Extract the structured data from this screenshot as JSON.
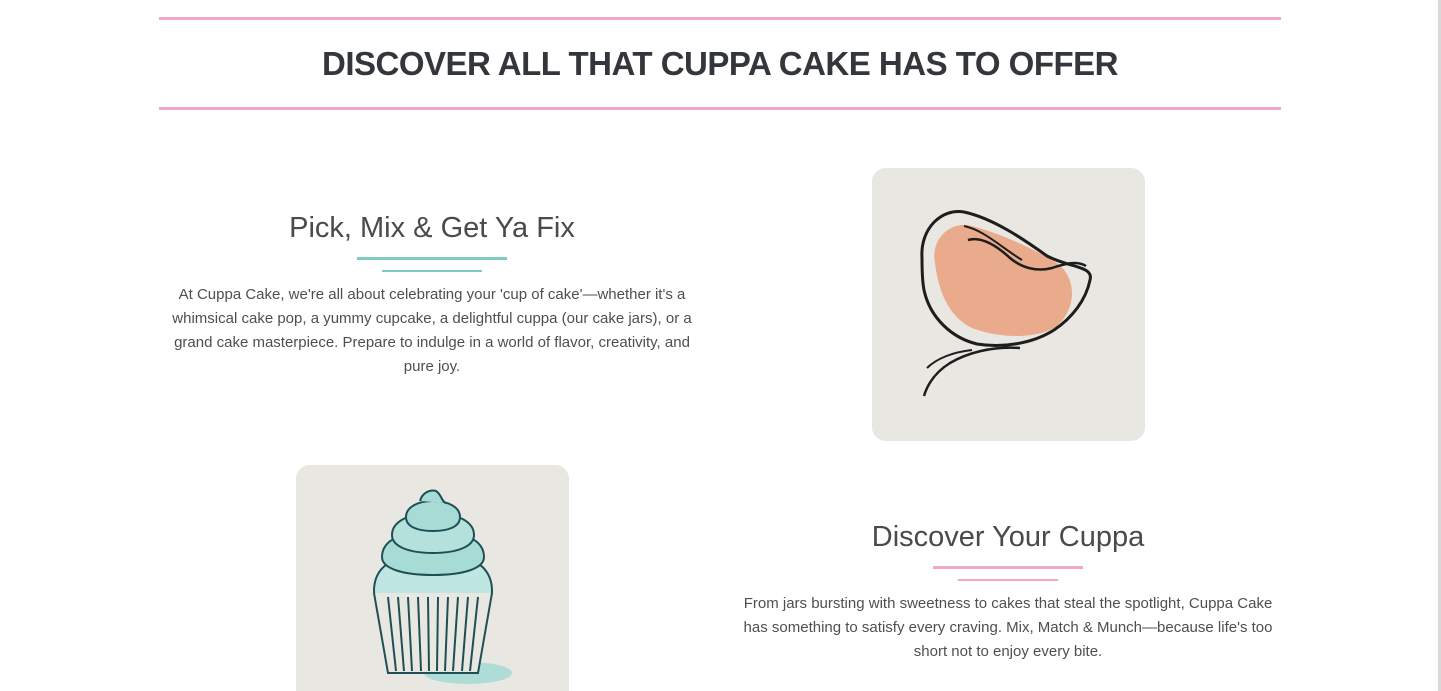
{
  "banner": {
    "heading": "DISCOVER ALL THAT CUPPA CAKE HAS TO OFFER"
  },
  "features": [
    {
      "title": "Pick, Mix & Get Ya Fix",
      "text": "At Cuppa Cake, we're all about celebrating your 'cup of cake'—whether it's a whimsical cake pop, a yummy cupcake, a delightful cuppa (our cake jars), or a grand cake masterpiece. Prepare to indulge in a world of flavor, creativity, and pure joy.",
      "accent_color": "#7fcbc3",
      "image_icon": "abstract-line-art-icon"
    },
    {
      "title": "Discover Your Cuppa",
      "text": "From jars bursting with sweetness to cakes that steal the spotlight, Cuppa Cake has something to satisfy every craving. Mix, Match & Munch—because life's too short not to enjoy every bite.",
      "accent_color": "#f1a7c8",
      "image_icon": "cupcake-icon"
    }
  ],
  "colors": {
    "banner_border": "#f1a7c8",
    "heading": "#33363b",
    "card_background": "#e9e7e2",
    "peach": "#e9a887",
    "teal": "#a7dcd6"
  }
}
